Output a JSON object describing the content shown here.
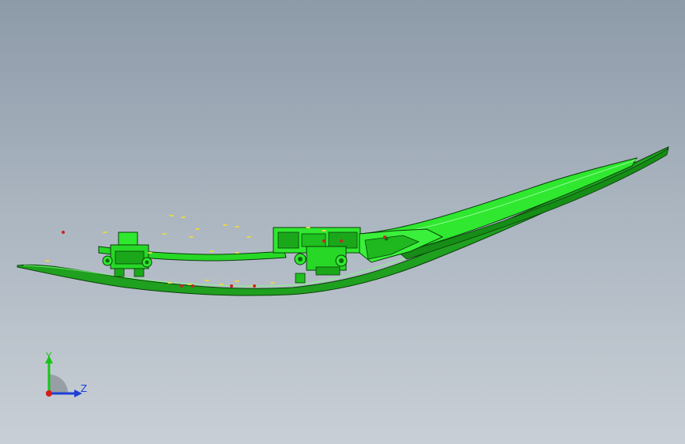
{
  "viewport": {
    "background_top": "#8d9aa8",
    "background_bottom": "#c9cfd6"
  },
  "model": {
    "part_color": "#22e222",
    "part_shadow_color": "#0e6b0e",
    "edge_color": "#0a3f0a",
    "point_color_yellow": "#e8d64a",
    "point_color_red": "#c8242a"
  },
  "triad": {
    "y_label": "Y",
    "z_label": "Z",
    "y_color": "#19c419",
    "z_color": "#1d3fd6",
    "x_color": "#d81c1c"
  }
}
